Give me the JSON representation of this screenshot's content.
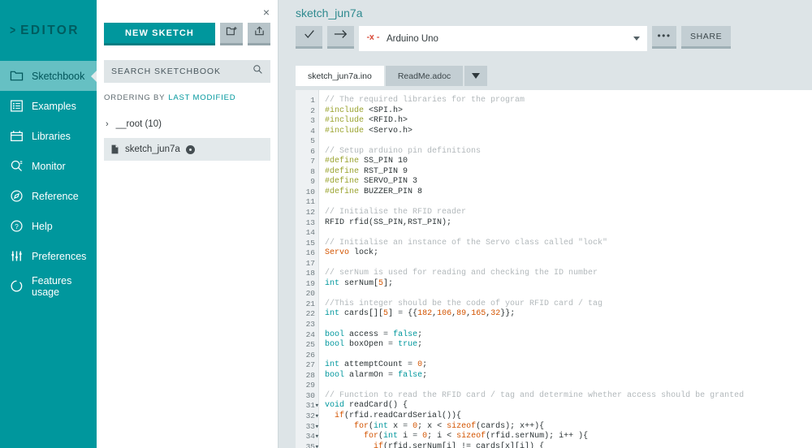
{
  "nav": {
    "logo": "EDITOR",
    "logo_chevron": ">",
    "items": [
      {
        "label": "Sketchbook",
        "icon": "folder-icon",
        "active": true
      },
      {
        "label": "Examples",
        "icon": "list-icon",
        "active": false
      },
      {
        "label": "Libraries",
        "icon": "library-icon",
        "active": false
      },
      {
        "label": "Monitor",
        "icon": "monitor-search-icon",
        "active": false
      },
      {
        "label": "Reference",
        "icon": "compass-icon",
        "active": false
      },
      {
        "label": "Help",
        "icon": "question-circle-icon",
        "active": false
      },
      {
        "label": "Preferences",
        "icon": "sliders-icon",
        "active": false
      },
      {
        "label": "Features usage",
        "icon": "refresh-circle-icon",
        "active": false
      }
    ]
  },
  "panel": {
    "close_label": "×",
    "new_sketch_label": "NEW SKETCH",
    "new_folder_icon": "new-folder-icon",
    "upload_icon": "upload-icon",
    "search_placeholder": "SEARCH SKETCHBOOK",
    "search_value": "",
    "search_icon": "search-icon",
    "ordering_label": "ORDERING BY",
    "ordering_value": "LAST MODIFIED",
    "tree": [
      {
        "label": "__root (10)",
        "type": "folder",
        "caret": "›"
      },
      {
        "label": "sketch_jun7a",
        "type": "file",
        "selected": true
      }
    ]
  },
  "main": {
    "sketch_title": "sketch_jun7a",
    "toolbar": {
      "verify_icon": "check-icon",
      "upload_icon": "arrow-right-icon",
      "board_icon": "arduino-board-icon",
      "board_name": "Arduino Uno",
      "more_label": "•••",
      "share_label": "SHARE"
    },
    "tabs": [
      {
        "label": "sketch_jun7a.ino",
        "active": true
      },
      {
        "label": "ReadMe.adoc",
        "active": false
      }
    ],
    "tab_more_icon": "chevron-down-icon"
  },
  "colors": {
    "brand_teal": "#00979d",
    "nav_active": "#66c0c3",
    "main_bg": "#dde4e7",
    "toolbar_btn": "#c3ced3",
    "comment": "#b2b8bb",
    "preprocessor": "#9aa32e",
    "keyword": "#00979d",
    "type_orange": "#d35400"
  },
  "editor": {
    "lines": [
      {
        "n": 1,
        "fold": false,
        "tokens": [
          [
            "cm",
            "// The required libraries for the program"
          ]
        ]
      },
      {
        "n": 2,
        "fold": false,
        "tokens": [
          [
            "pp",
            "#include"
          ],
          [
            "tx",
            " <SPI.h>"
          ]
        ]
      },
      {
        "n": 3,
        "fold": false,
        "tokens": [
          [
            "pp",
            "#include"
          ],
          [
            "tx",
            " <RFID.h>"
          ]
        ]
      },
      {
        "n": 4,
        "fold": false,
        "tokens": [
          [
            "pp",
            "#include"
          ],
          [
            "tx",
            " <Servo.h>"
          ]
        ]
      },
      {
        "n": 5,
        "fold": false,
        "tokens": []
      },
      {
        "n": 6,
        "fold": false,
        "tokens": [
          [
            "cm",
            "// Setup arduino pin definitions"
          ]
        ]
      },
      {
        "n": 7,
        "fold": false,
        "tokens": [
          [
            "pp",
            "#define"
          ],
          [
            "tx",
            " SS_PIN 10"
          ]
        ]
      },
      {
        "n": 8,
        "fold": false,
        "tokens": [
          [
            "pp",
            "#define"
          ],
          [
            "tx",
            " RST_PIN 9"
          ]
        ]
      },
      {
        "n": 9,
        "fold": false,
        "tokens": [
          [
            "pp",
            "#define"
          ],
          [
            "tx",
            " SERVO_PIN 3"
          ]
        ]
      },
      {
        "n": 10,
        "fold": false,
        "tokens": [
          [
            "pp",
            "#define"
          ],
          [
            "tx",
            " BUZZER_PIN 8"
          ]
        ]
      },
      {
        "n": 11,
        "fold": false,
        "tokens": []
      },
      {
        "n": 12,
        "fold": false,
        "tokens": [
          [
            "cm",
            "// Initialise the RFID reader"
          ]
        ]
      },
      {
        "n": 13,
        "fold": false,
        "tokens": [
          [
            "tx",
            "RFID rfid(SS_PIN,RST_PIN);"
          ]
        ]
      },
      {
        "n": 14,
        "fold": false,
        "tokens": []
      },
      {
        "n": 15,
        "fold": false,
        "tokens": [
          [
            "cm",
            "// Initialise an instance of the Servo class called \"lock\""
          ]
        ]
      },
      {
        "n": 16,
        "fold": false,
        "tokens": [
          [
            "ty",
            "Servo"
          ],
          [
            "tx",
            " lock;"
          ]
        ]
      },
      {
        "n": 17,
        "fold": false,
        "tokens": []
      },
      {
        "n": 18,
        "fold": false,
        "tokens": [
          [
            "cm",
            "// serNum is used for reading and checking the ID number"
          ]
        ]
      },
      {
        "n": 19,
        "fold": false,
        "tokens": [
          [
            "kw",
            "int"
          ],
          [
            "tx",
            " serNum["
          ],
          [
            "ty",
            "5"
          ],
          [
            "tx",
            "];"
          ]
        ]
      },
      {
        "n": 20,
        "fold": false,
        "tokens": []
      },
      {
        "n": 21,
        "fold": false,
        "tokens": [
          [
            "cm",
            "//This integer should be the code of your RFID card / tag"
          ]
        ]
      },
      {
        "n": 22,
        "fold": false,
        "tokens": [
          [
            "kw",
            "int"
          ],
          [
            "tx",
            " cards[]["
          ],
          [
            "ty",
            "5"
          ],
          [
            "tx",
            "] "
          ],
          [
            "op",
            "="
          ],
          [
            "tx",
            " {{"
          ],
          [
            "ty",
            "182"
          ],
          [
            "tx",
            ","
          ],
          [
            "ty",
            "106"
          ],
          [
            "tx",
            ","
          ],
          [
            "ty",
            "89"
          ],
          [
            "tx",
            ","
          ],
          [
            "ty",
            "165"
          ],
          [
            "tx",
            ","
          ],
          [
            "ty",
            "32"
          ],
          [
            "tx",
            "}};"
          ]
        ]
      },
      {
        "n": 23,
        "fold": false,
        "tokens": []
      },
      {
        "n": 24,
        "fold": false,
        "tokens": [
          [
            "kw",
            "bool"
          ],
          [
            "tx",
            " access "
          ],
          [
            "op",
            "="
          ],
          [
            "tx",
            " "
          ],
          [
            "kw",
            "false"
          ],
          [
            "tx",
            ";"
          ]
        ]
      },
      {
        "n": 25,
        "fold": false,
        "tokens": [
          [
            "kw",
            "bool"
          ],
          [
            "tx",
            " boxOpen "
          ],
          [
            "op",
            "="
          ],
          [
            "tx",
            " "
          ],
          [
            "kw",
            "true"
          ],
          [
            "tx",
            ";"
          ]
        ]
      },
      {
        "n": 26,
        "fold": false,
        "tokens": []
      },
      {
        "n": 27,
        "fold": false,
        "tokens": [
          [
            "kw",
            "int"
          ],
          [
            "tx",
            " attemptCount "
          ],
          [
            "op",
            "="
          ],
          [
            "tx",
            " "
          ],
          [
            "ty",
            "0"
          ],
          [
            "tx",
            ";"
          ]
        ]
      },
      {
        "n": 28,
        "fold": false,
        "tokens": [
          [
            "kw",
            "bool"
          ],
          [
            "tx",
            " alarmOn "
          ],
          [
            "op",
            "="
          ],
          [
            "tx",
            " "
          ],
          [
            "kw",
            "false"
          ],
          [
            "tx",
            ";"
          ]
        ]
      },
      {
        "n": 29,
        "fold": false,
        "tokens": []
      },
      {
        "n": 30,
        "fold": false,
        "tokens": [
          [
            "cm",
            "// Function to read the RFID card / tag and determine whether access should be granted"
          ]
        ]
      },
      {
        "n": 31,
        "fold": true,
        "tokens": [
          [
            "kw",
            "void"
          ],
          [
            "tx",
            " readCard() {"
          ]
        ]
      },
      {
        "n": 32,
        "fold": true,
        "tokens": [
          [
            "tx",
            "  "
          ],
          [
            "fn",
            "if"
          ],
          [
            "tx",
            "(rfid.readCardSerial()){"
          ]
        ]
      },
      {
        "n": 33,
        "fold": true,
        "tokens": [
          [
            "tx",
            "      "
          ],
          [
            "fn",
            "for"
          ],
          [
            "tx",
            "("
          ],
          [
            "kw",
            "int"
          ],
          [
            "tx",
            " x "
          ],
          [
            "op",
            "="
          ],
          [
            "tx",
            " "
          ],
          [
            "ty",
            "0"
          ],
          [
            "tx",
            "; x < "
          ],
          [
            "fn",
            "sizeof"
          ],
          [
            "tx",
            "(cards); x++){"
          ]
        ]
      },
      {
        "n": 34,
        "fold": true,
        "tokens": [
          [
            "tx",
            "        "
          ],
          [
            "fn",
            "for"
          ],
          [
            "tx",
            "("
          ],
          [
            "kw",
            "int"
          ],
          [
            "tx",
            " i "
          ],
          [
            "op",
            "="
          ],
          [
            "tx",
            " "
          ],
          [
            "ty",
            "0"
          ],
          [
            "tx",
            "; i < "
          ],
          [
            "fn",
            "sizeof"
          ],
          [
            "tx",
            "(rfid.serNum); i++ ){"
          ]
        ]
      },
      {
        "n": 35,
        "fold": true,
        "tokens": [
          [
            "tx",
            "          "
          ],
          [
            "fn",
            "if"
          ],
          [
            "tx",
            "(rfid.serNum[i] != cards[x][i]) {"
          ]
        ]
      }
    ]
  }
}
